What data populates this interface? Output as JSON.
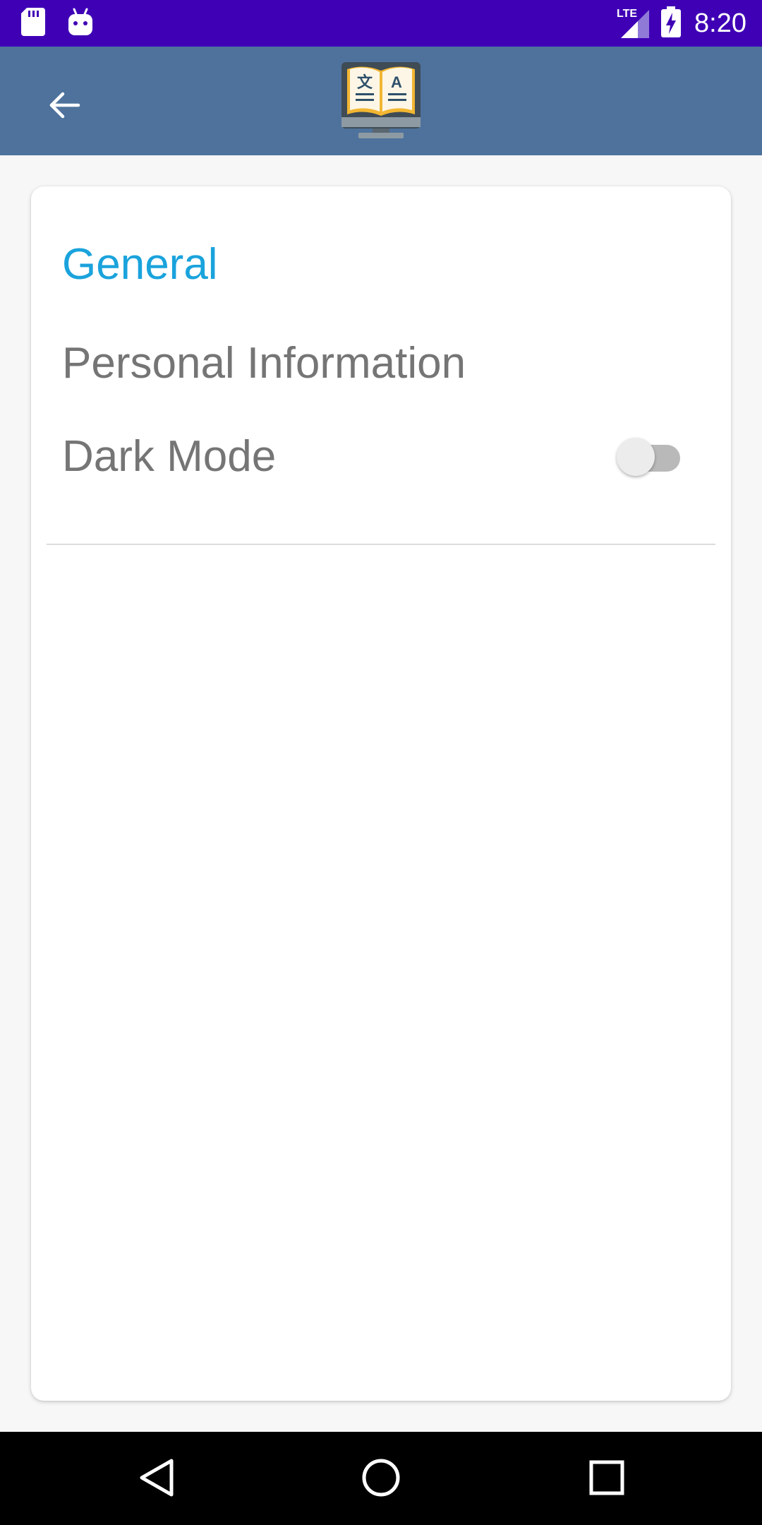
{
  "status_bar": {
    "time": "8:20",
    "network_label": "LTE",
    "icons": [
      "sd-card-icon",
      "android-icon",
      "lte-signal-icon",
      "battery-charging-icon"
    ]
  },
  "app_bar": {
    "back_icon": "arrow-back-icon",
    "logo_icon": "dictionary-translate-logo",
    "logo_glyph_left": "文",
    "logo_glyph_right": "A",
    "background_color": "#4e729c"
  },
  "settings": {
    "section_title": "General",
    "items": [
      {
        "label": "Personal Information"
      },
      {
        "label": "Dark Mode",
        "toggle_on": false
      }
    ],
    "accent_color": "#1aa3dc"
  },
  "nav_bar": {
    "icons": [
      "nav-back-icon",
      "nav-home-icon",
      "nav-recents-icon"
    ]
  }
}
